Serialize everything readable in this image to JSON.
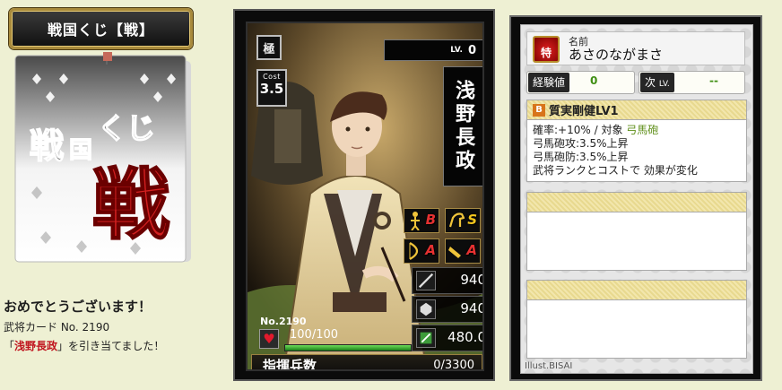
{
  "banner": {
    "title": "戦国くじ【戦】"
  },
  "lottery_card": {
    "text_small": "戦",
    "text_guo": "国",
    "text_kuji": "くじ",
    "text_big": "戦"
  },
  "result": {
    "headline": "おめでとうございます！",
    "card_line": "武将カード No. 2190",
    "name_prefix": "「",
    "name": "浅野長政",
    "name_suffix": "」を引き当てました！"
  },
  "card": {
    "rarity": "極",
    "cost_label": "Cost",
    "cost_value": "3.5",
    "level_label": "LV.",
    "level_value": "0",
    "name": "浅野長政",
    "skills": [
      {
        "icon": "bow-figure-icon",
        "grade": "B"
      },
      {
        "icon": "horse-icon",
        "grade": "S"
      },
      {
        "icon": "bow-icon",
        "grade": "A"
      },
      {
        "icon": "gun-icon",
        "grade": "A"
      }
    ],
    "stats": [
      {
        "icon": "attack-icon",
        "value": "940"
      },
      {
        "icon": "defense-icon",
        "value": "940"
      },
      {
        "icon": "strategy-icon",
        "value": "480.0"
      }
    ],
    "number": "No.2190",
    "hp_text": "100/100",
    "hp_ratio": 1.0,
    "troops_label": "指揮兵数",
    "troops_value": "0/3300"
  },
  "info": {
    "name_label": "名前",
    "name_value": "あさのながまさ",
    "general_icon_text": "特",
    "exp_label": "経験値",
    "exp_value": "0",
    "next_label": "次",
    "next_label_small": "LV.",
    "next_value": "--",
    "skill": {
      "grade": "B",
      "name": "質実剛健LV1",
      "rate_line": "確率:+10%  /  対象",
      "target": "弓馬砲",
      "lines": [
        "弓馬砲攻:3.5%上昇",
        "弓馬砲防:3.5%上昇",
        "武将ランクとコストで 効果が変化"
      ]
    },
    "illust": "Illust.BISAI"
  },
  "colors": {
    "background": "#eef0d3",
    "accent_gold": "#a88a3c",
    "highlight_red": "#c0141e",
    "value_green": "#3e8e12"
  }
}
